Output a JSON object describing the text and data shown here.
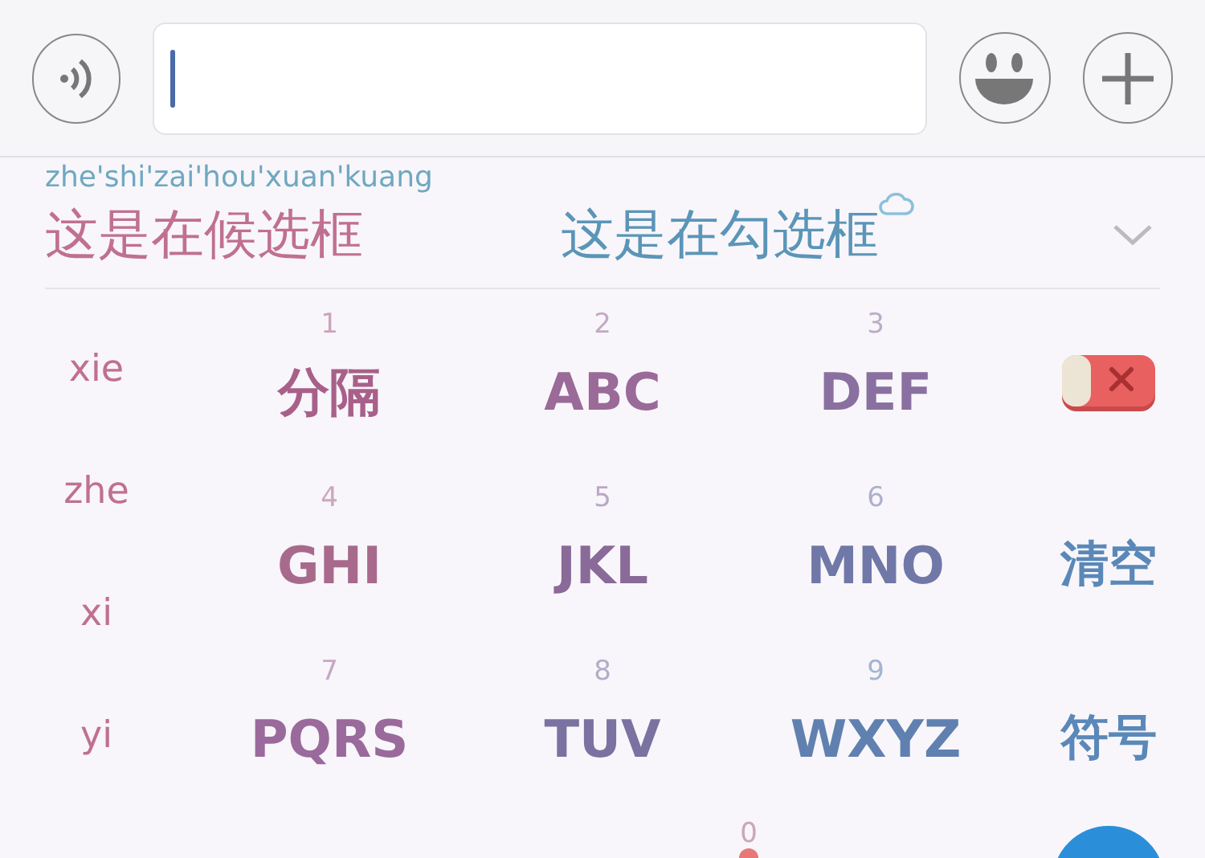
{
  "composition": "zhe'shi'zai'hou'xuan'kuang",
  "candidates": [
    {
      "text": "这是在候选框",
      "color": "#c07090",
      "cloud": false
    },
    {
      "text": "这是在勾选框",
      "color": "#5b95b8",
      "cloud": true
    }
  ],
  "pinyin_options": [
    "xie",
    "zhe",
    "xi",
    "yi"
  ],
  "keys": [
    {
      "kind": "key",
      "digit": "1",
      "label": "分隔",
      "color": "#a8608a"
    },
    {
      "kind": "key",
      "digit": "2",
      "label": "ABC",
      "color": "#9a6a98"
    },
    {
      "kind": "key",
      "digit": "3",
      "label": "DEF",
      "color": "#8a70a0"
    },
    {
      "kind": "delete"
    },
    {
      "kind": "key",
      "digit": "4",
      "label": "GHI",
      "color": "#a86a8c"
    },
    {
      "kind": "key",
      "digit": "5",
      "label": "JKL",
      "color": "#8a6a98"
    },
    {
      "kind": "key",
      "digit": "6",
      "label": "MNO",
      "color": "#7078a8"
    },
    {
      "kind": "action",
      "label": "清空",
      "color": "#5a88b8"
    },
    {
      "kind": "key",
      "digit": "7",
      "label": "PQRS",
      "color": "#9a6a9c"
    },
    {
      "kind": "key",
      "digit": "8",
      "label": "TUV",
      "color": "#7a72a0"
    },
    {
      "kind": "key",
      "digit": "9",
      "label": "WXYZ",
      "color": "#6080b0"
    },
    {
      "kind": "action",
      "label": "符号",
      "color": "#5a88b8"
    }
  ],
  "bottom_key": {
    "digit": "0"
  }
}
